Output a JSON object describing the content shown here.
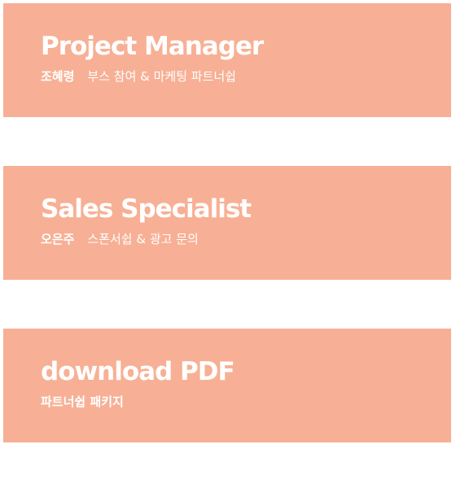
{
  "accent_color": "#f7b095",
  "cards": [
    {
      "title": "Project Manager",
      "name": "조혜령",
      "description": "부스 참여 & 마케팅 파트너쉽"
    },
    {
      "title": "Sales Specialist",
      "name": "오은주",
      "description": "스폰서쉽 & 광고 문의"
    },
    {
      "title": "download PDF",
      "description": "파트너쉽 패키지"
    }
  ]
}
